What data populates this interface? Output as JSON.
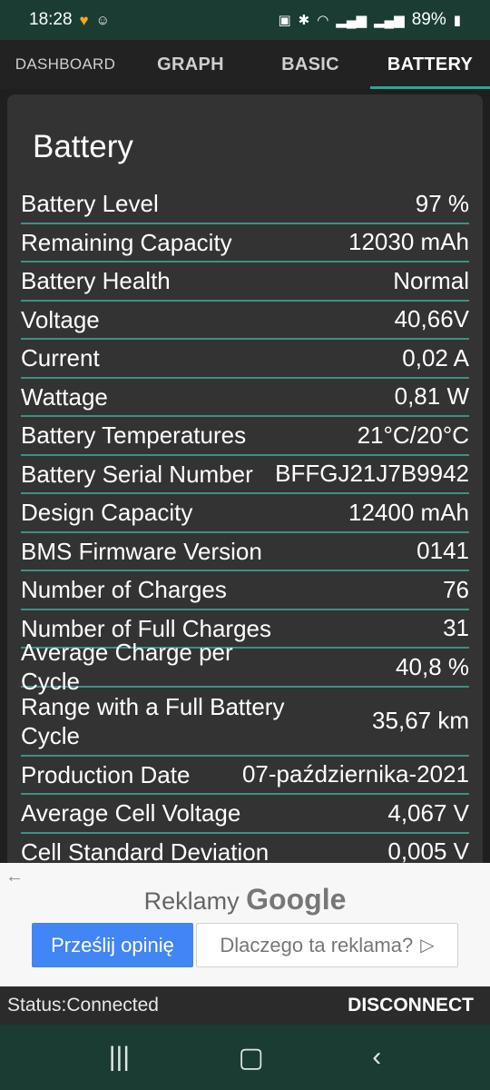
{
  "status_bar": {
    "time": "18:28",
    "battery_percent": "89%",
    "icons_left": [
      "heart-bolt-icon",
      "smiley-icon"
    ],
    "icons_right": [
      "battery-saver-icon",
      "bluetooth-icon",
      "wifi-icon",
      "signal-icon",
      "signal-icon-2",
      "battery-icon"
    ]
  },
  "tabs": [
    {
      "label": "DASHBOARD",
      "display": "DASHBOA\nRD",
      "active": false
    },
    {
      "label": "GRAPH",
      "active": false
    },
    {
      "label": "BASIC",
      "active": false
    },
    {
      "label": "BATTERY",
      "active": true
    }
  ],
  "card": {
    "title": "Battery",
    "rows": [
      {
        "label": "Battery Level",
        "value": "97 %"
      },
      {
        "label": "Remaining Capacity",
        "value": "12030 mAh"
      },
      {
        "label": "Battery Health",
        "value": "Normal"
      },
      {
        "label": "Voltage",
        "value": "40,66V"
      },
      {
        "label": "Current",
        "value": "0,02 A"
      },
      {
        "label": "Wattage",
        "value": "0,81 W"
      },
      {
        "label": "Battery Temperatures",
        "value": "21°C/20°C"
      },
      {
        "label": "Battery Serial Number",
        "value": "BFFGJ21J7B9942"
      },
      {
        "label": "Design Capacity",
        "value": "12400 mAh"
      },
      {
        "label": "BMS Firmware Version",
        "value": "0141"
      },
      {
        "label": "Number of Charges",
        "value": "76"
      },
      {
        "label": "Number of Full Charges",
        "value": "31"
      },
      {
        "label": "Average Charge per Cycle",
        "value": "40,8 %"
      },
      {
        "label": "Range with a Full Battery Cycle",
        "value": "35,67 km"
      },
      {
        "label": "Production Date",
        "value": "07-października-2021"
      },
      {
        "label": "Average Cell Voltage",
        "value": "4,067 V"
      },
      {
        "label": "Cell Standard Deviation",
        "value": "0,005 V"
      }
    ]
  },
  "ad": {
    "title_prefix": "Reklamy",
    "title_brand": "Google",
    "primary_button": "Prześlij opinię",
    "secondary_button": "Dlaczego ta reklama?"
  },
  "connection": {
    "status": "Status:Connected",
    "button": "DISCONNECT"
  },
  "nav": {
    "icons": [
      "recent-apps-icon",
      "home-icon",
      "back-icon"
    ]
  }
}
